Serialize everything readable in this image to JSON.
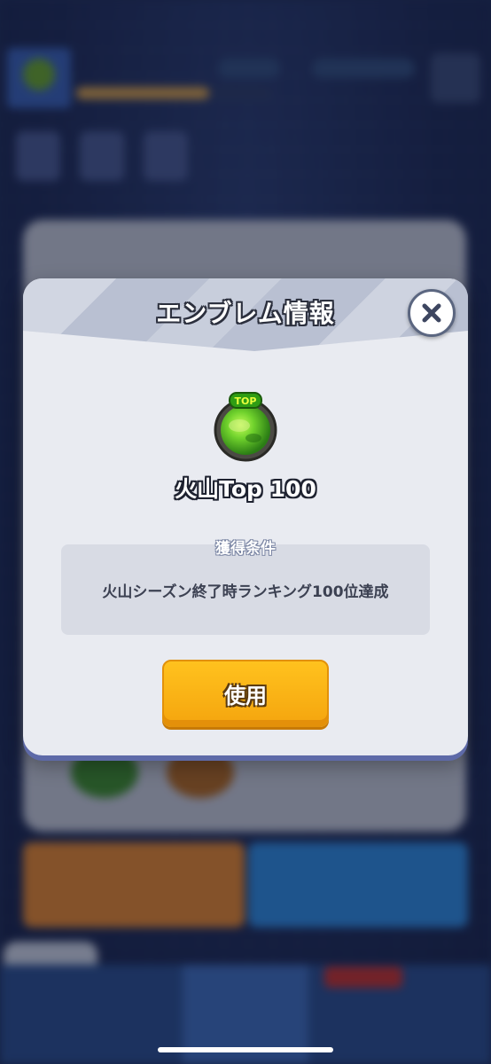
{
  "modal": {
    "title": "エンブレム情報",
    "emblem": {
      "name": "火山Top 100",
      "badge_text": "TOP",
      "icon": "green-planet-emblem-icon"
    },
    "condition_label": "獲得条件",
    "condition_text": "火山シーズン終了時ランキング100位達成",
    "use_button_label": "使用",
    "close_icon": "close-icon"
  },
  "colors": {
    "modal_bg": "#e9ebf1",
    "header_bg": "#b9c0d2",
    "use_button": "#f7ab12",
    "close_border": "#5b6680"
  }
}
